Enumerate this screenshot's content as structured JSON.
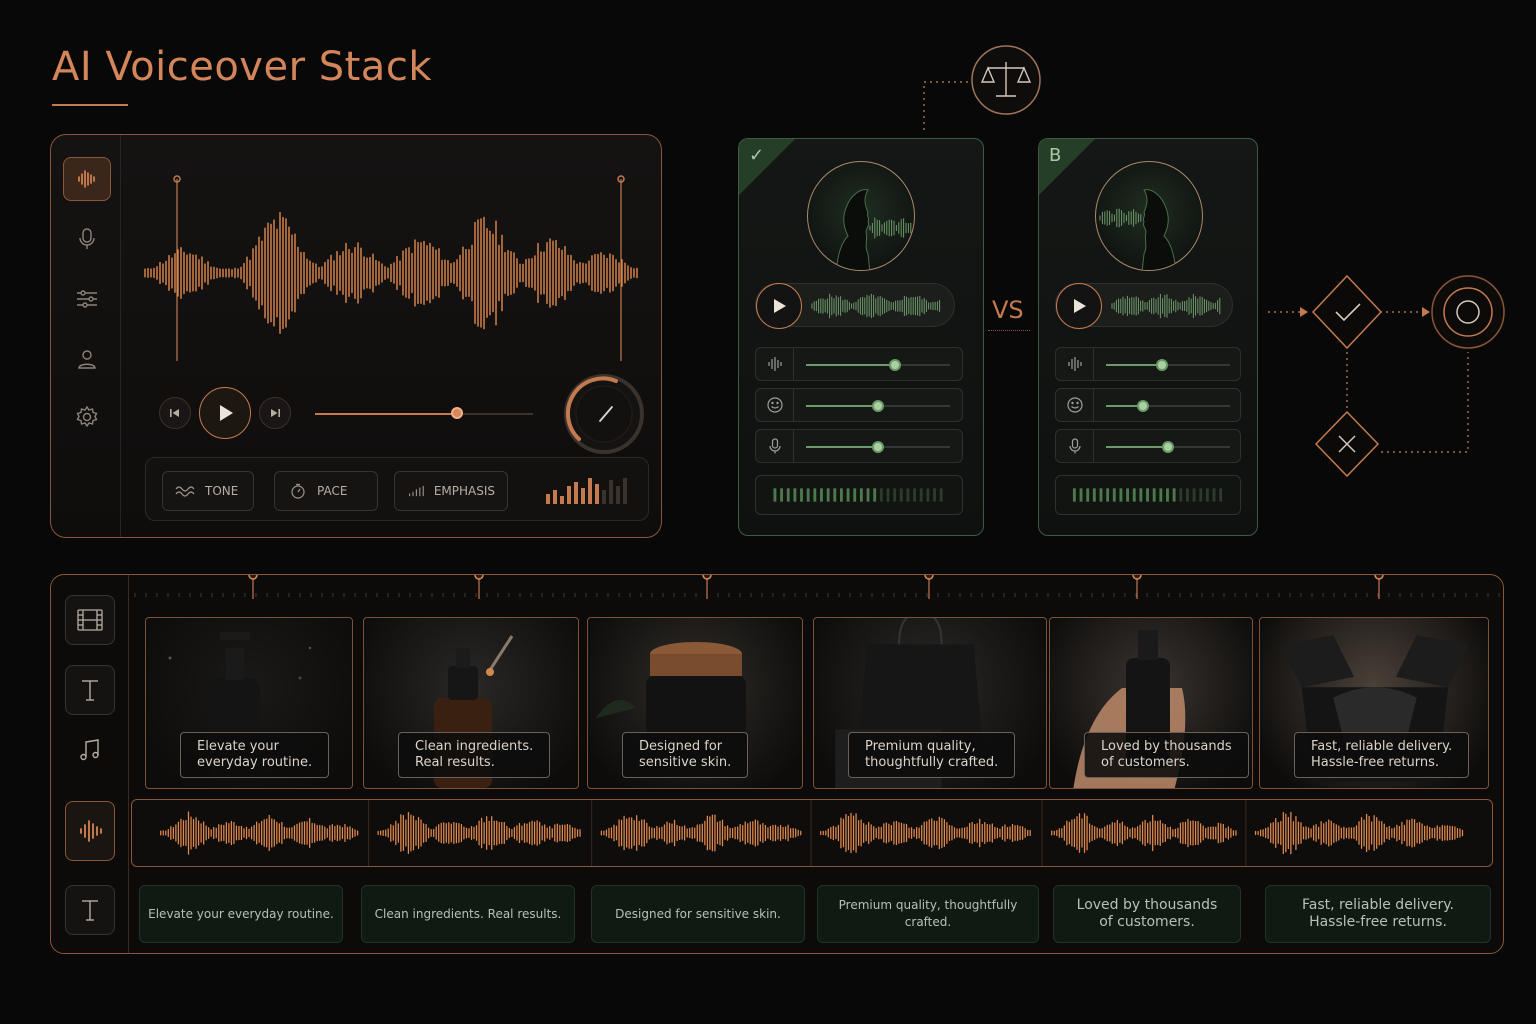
{
  "header": {
    "title": "AI Voiceover Stack"
  },
  "editor": {
    "sidebar": [
      {
        "icon": "waveform-icon",
        "active": true
      },
      {
        "icon": "microphone-icon",
        "active": false
      },
      {
        "icon": "sliders-icon",
        "active": false
      },
      {
        "icon": "user-icon",
        "active": false
      },
      {
        "icon": "gear-icon",
        "active": false
      }
    ],
    "progress": 0.65,
    "controls": {
      "tone": "TONE",
      "pace": "PACE",
      "emphasis": "EMPHASIS"
    }
  },
  "compare": {
    "vs": "VS",
    "card_a": {
      "badge": "✓",
      "sliders": [
        0.62,
        0.5,
        0.5
      ]
    },
    "card_b": {
      "badge": "B",
      "sliders": [
        0.45,
        0.3,
        0.5
      ]
    }
  },
  "timeline": {
    "clips": [
      {
        "caption": "Elevate your\neveryday routine.",
        "scene": "pump-bottle"
      },
      {
        "caption": "Clean ingredients.\nReal results.",
        "scene": "dropper-bottle"
      },
      {
        "caption": "Designed for\nsensitive skin.",
        "scene": "cream-jar"
      },
      {
        "caption": "Premium quality,\nthoughtfully crafted.",
        "scene": "shopping-bag"
      },
      {
        "caption": "Loved by thousands\nof customers.",
        "scene": "hand-bottle"
      },
      {
        "caption": "Fast, reliable delivery.\nHassle-free returns.",
        "scene": "gift-box"
      }
    ],
    "subtitles": [
      "Elevate your everyday routine.",
      "Clean ingredients. Real results.",
      "Designed for sensitive skin.",
      "Premium quality, thoughtfully crafted.",
      "Loved by thousands\nof customers.",
      "Fast, reliable delivery.\nHassle-free returns."
    ]
  },
  "colors": {
    "accent": "#c47a4e",
    "green": "#6e9a6b",
    "bg": "#080808"
  }
}
